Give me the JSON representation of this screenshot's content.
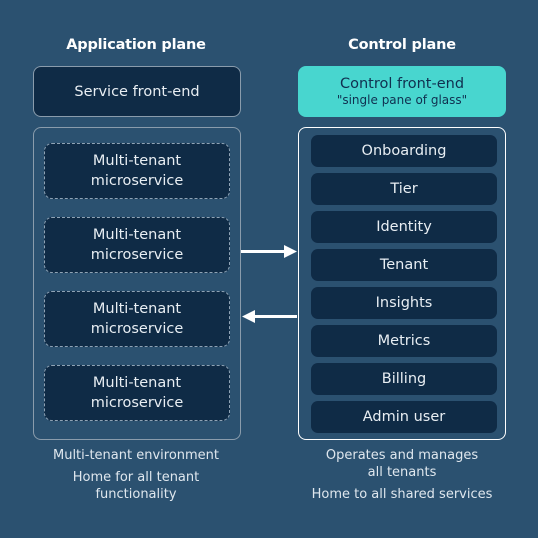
{
  "application_plane": {
    "title": "Application plane",
    "front_end": "Service front-end",
    "microservices": [
      {
        "line1": "Multi-tenant",
        "line2": "microservice"
      },
      {
        "line1": "Multi-tenant",
        "line2": "microservice"
      },
      {
        "line1": "Multi-tenant",
        "line2": "microservice"
      },
      {
        "line1": "Multi-tenant",
        "line2": "microservice"
      }
    ],
    "captions": {
      "environment": "Multi-tenant environment",
      "home_line1": "Home for all tenant",
      "home_line2": "functionality"
    }
  },
  "control_plane": {
    "title": "Control plane",
    "front_end": {
      "title": "Control front-end",
      "subtitle": "\"single pane of glass\""
    },
    "services": [
      "Onboarding",
      "Tier",
      "Identity",
      "Tenant",
      "Insights",
      "Metrics",
      "Billing",
      "Admin user"
    ],
    "captions": {
      "operates_line1": "Operates and manages",
      "operates_line2": "all tenants",
      "home": "Home to all shared services"
    }
  },
  "arrows": [
    {
      "from": "application_plane",
      "to": "control_plane",
      "direction": "right"
    },
    {
      "from": "control_plane",
      "to": "application_plane",
      "direction": "left"
    }
  ],
  "colors": {
    "background": "#2b5170",
    "box_dark": "#0f2b46",
    "accent_teal": "#48d6cf",
    "text_light": "#ffffff"
  }
}
